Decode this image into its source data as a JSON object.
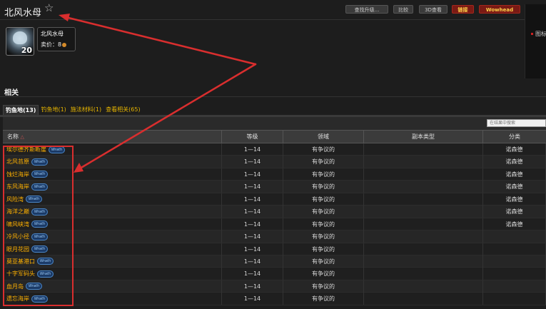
{
  "page": {
    "title": "北风水母"
  },
  "toolbar": {
    "buttons": [
      {
        "label": "查找升级..."
      },
      {
        "label": "比较"
      },
      {
        "label": "3D查看"
      },
      {
        "label": "链接"
      },
      {
        "label": "Wowhead"
      }
    ]
  },
  "side_panel": {
    "text": "图标"
  },
  "item": {
    "count": "20",
    "name": "北风水母",
    "price_label": "卖价：8"
  },
  "related": {
    "title": "相关",
    "tabs": [
      {
        "label": "钓鱼地(13)"
      },
      {
        "label": "钓鱼地(1)"
      },
      {
        "label": "施法材料(1)"
      },
      {
        "label": "查看相关(65)"
      }
    ],
    "search_placeholder": "在结果中搜索"
  },
  "table": {
    "columns": [
      "名称",
      "等级",
      "领域",
      "副本类型",
      "分类"
    ],
    "badge_text": "Wrath",
    "rows": [
      {
        "name": "埃尔德齐斯断崖",
        "level": "1—14",
        "realm": "有争议的",
        "instance": "",
        "category": "诺森德"
      },
      {
        "name": "北风苔原",
        "level": "1—14",
        "realm": "有争议的",
        "instance": "",
        "category": "诺森德"
      },
      {
        "name": "蚀烂海岸",
        "level": "1—14",
        "realm": "有争议的",
        "instance": "",
        "category": "诺森德"
      },
      {
        "name": "东风海岸",
        "level": "1—14",
        "realm": "有争议的",
        "instance": "",
        "category": "诺森德"
      },
      {
        "name": "风险湾",
        "level": "1—14",
        "realm": "有争议的",
        "instance": "",
        "category": "诺森德"
      },
      {
        "name": "海洋之巅",
        "level": "1—14",
        "realm": "有争议的",
        "instance": "",
        "category": "诺森德"
      },
      {
        "name": "啸风峡湾",
        "level": "1—14",
        "realm": "有争议的",
        "instance": "",
        "category": "诺森德"
      },
      {
        "name": "冷风小径",
        "level": "1—14",
        "realm": "有争议的",
        "instance": "",
        "category": ""
      },
      {
        "name": "眼月花园",
        "level": "1—14",
        "realm": "有争议的",
        "instance": "",
        "category": ""
      },
      {
        "name": "莫亚基港口",
        "level": "1—14",
        "realm": "有争议的",
        "instance": "",
        "category": ""
      },
      {
        "name": "十字军码头",
        "level": "1—14",
        "realm": "有争议的",
        "instance": "",
        "category": ""
      },
      {
        "name": "血月岛",
        "level": "1—14",
        "realm": "有争议的",
        "instance": "",
        "category": ""
      },
      {
        "name": "遗忘海岸",
        "level": "1—14",
        "realm": "有争议的",
        "instance": "",
        "category": ""
      }
    ]
  },
  "colors": {
    "background": "#1d1d1d",
    "zone_link": "#ffb100",
    "tab_link": "#e7b500",
    "highlight_red": "#d92e2e",
    "button_red": "#7a1a14"
  }
}
